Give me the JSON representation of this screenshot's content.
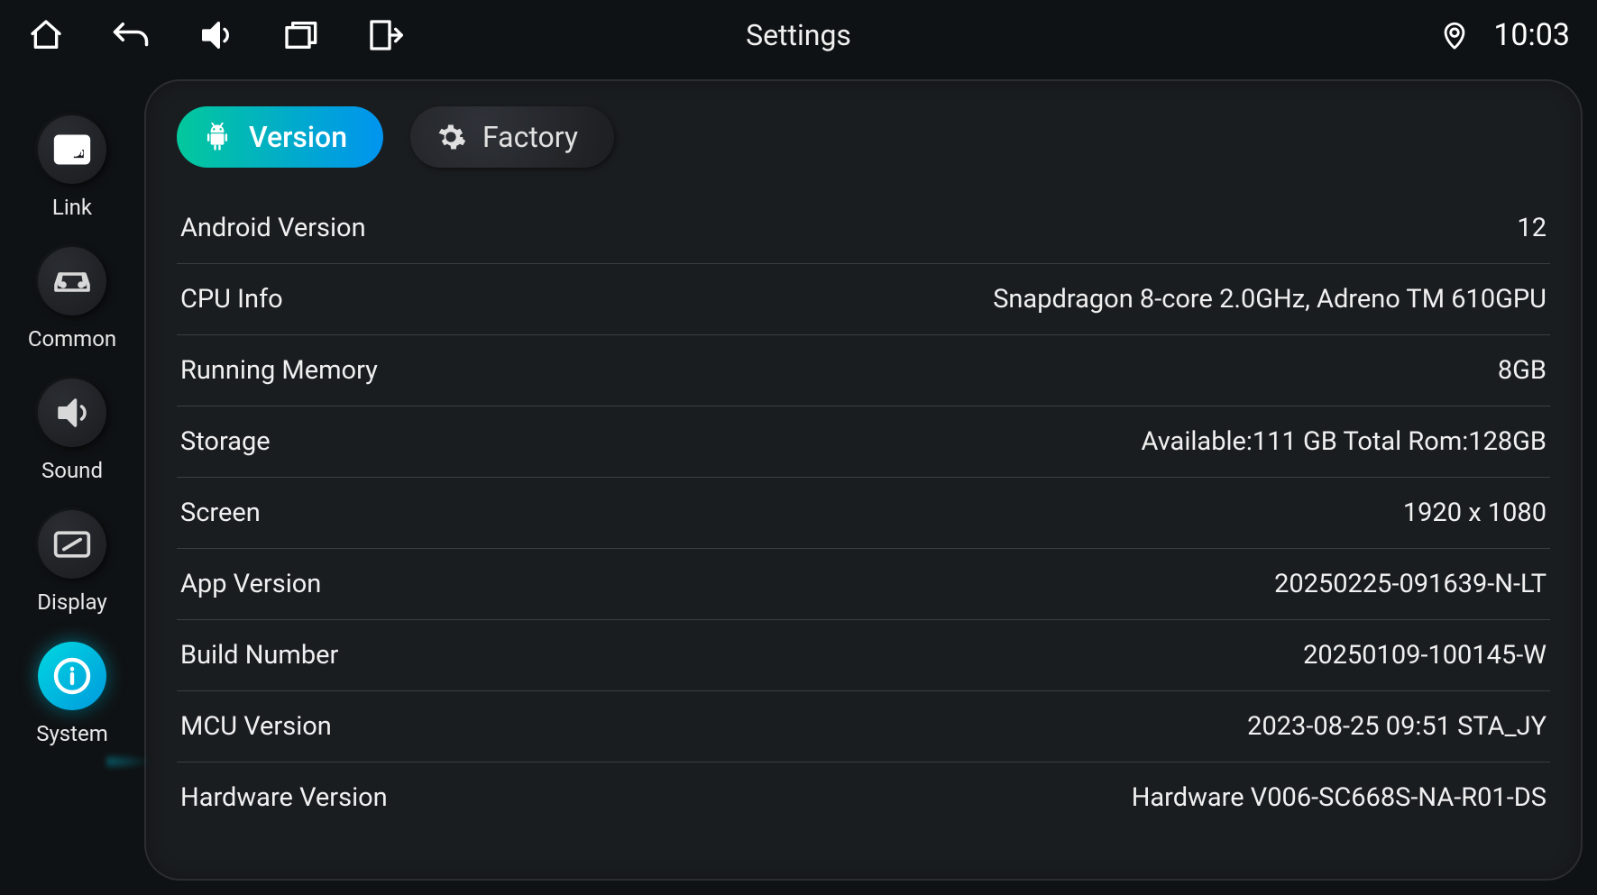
{
  "header": {
    "title": "Settings",
    "clock": "10:03"
  },
  "sidebar": {
    "items": [
      {
        "label": "Link",
        "icon": "cast-icon"
      },
      {
        "label": "Common",
        "icon": "car-icon"
      },
      {
        "label": "Sound",
        "icon": "volume-icon"
      },
      {
        "label": "Display",
        "icon": "display-icon"
      },
      {
        "label": "System",
        "icon": "info-icon"
      }
    ],
    "active_index": 4
  },
  "tabs": {
    "items": [
      {
        "label": "Version",
        "icon": "android-icon"
      },
      {
        "label": "Factory",
        "icon": "gear-icon"
      }
    ],
    "active_index": 0
  },
  "info": [
    {
      "label": "Android Version",
      "value": "12"
    },
    {
      "label": "CPU Info",
      "value": "Snapdragon 8-core 2.0GHz, Adreno TM 610GPU"
    },
    {
      "label": "Running Memory",
      "value": "8GB"
    },
    {
      "label": "Storage",
      "value": "Available:111 GB Total Rom:128GB"
    },
    {
      "label": "Screen",
      "value": "1920 x 1080"
    },
    {
      "label": "App Version",
      "value": "20250225-091639-N-LT"
    },
    {
      "label": "Build Number",
      "value": "20250109-100145-W"
    },
    {
      "label": "MCU Version",
      "value": "2023-08-25 09:51 STA_JY"
    },
    {
      "label": "Hardware Version",
      "value": "Hardware V006-SC668S-NA-R01-DS"
    }
  ]
}
